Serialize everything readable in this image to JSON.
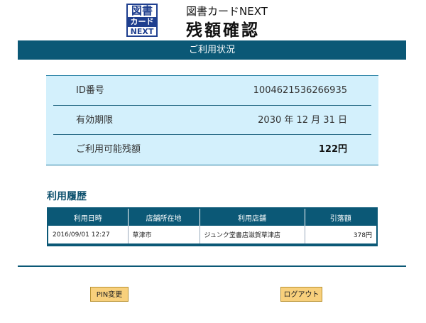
{
  "header": {
    "logo_line1": "図書",
    "logo_line2": "カード",
    "logo_line3": "NEXT",
    "brand": "図書カードNEXT",
    "title": "残額確認"
  },
  "section_band": "ご利用状況",
  "info": {
    "id_label": "ID番号",
    "id_value": "1004621536266935",
    "expiry_label": "有効期限",
    "expiry_value": "2030 年 12 月 31 日",
    "balance_label": "ご利用可能残額",
    "balance_value": "122円"
  },
  "history": {
    "title": "利用履歴",
    "columns": [
      "利用日時",
      "店舗所在地",
      "利用店舗",
      "引落額"
    ],
    "rows": [
      [
        "2016/09/01 12:27",
        "草津市",
        "ジュンク堂書店滋賀草津店",
        "378円"
      ]
    ]
  },
  "buttons": {
    "pin_change": "PIN変更",
    "logout": "ログアウト"
  },
  "colors": {
    "band": "#0b5876",
    "info_bg": "#d3f0fc",
    "button": "#f8d07c"
  }
}
